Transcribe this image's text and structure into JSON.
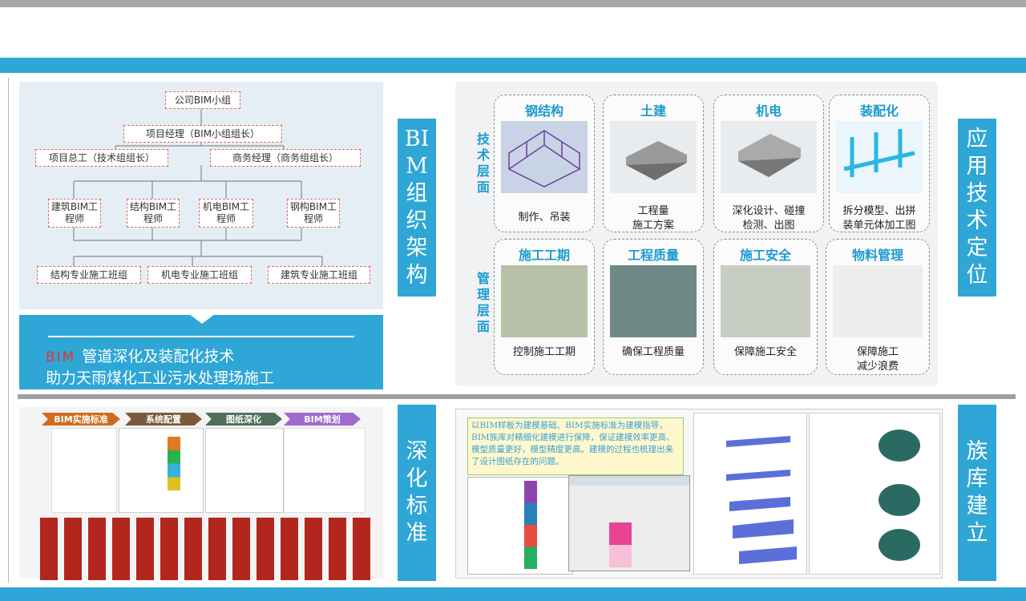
{
  "labels": {
    "org": "BIM组织架构",
    "tech": "应用技术定位",
    "deepen": "深化标准",
    "library": "族库建立"
  },
  "org_chart": {
    "company": "公司BIM小组",
    "pm": "项目经理（BIM小组组长）",
    "chief_engineer": "项目总工（技术组组长）",
    "business_manager": "商务经理（商务组组长）",
    "engineers": [
      "建筑BIM工程师",
      "结构BIM工程师",
      "机电BIM工程师",
      "钢构BIM工程师"
    ],
    "teams": [
      "结构专业施工班组",
      "机电专业施工班组",
      "建筑专业施工班组"
    ]
  },
  "caption": {
    "red": "BIM",
    "line1": "管道深化及装配化技术",
    "line2": "助力天雨煤化工业污水处理场施工"
  },
  "tech": {
    "side_tech": "技术层面",
    "side_mgmt": "管理层面",
    "tiles": [
      {
        "title": "钢结构",
        "caption": "制作、吊装"
      },
      {
        "title": "土建",
        "caption": "工程量\n施工方案"
      },
      {
        "title": "机电",
        "caption": "深化设计、碰撞\n检测、出图"
      },
      {
        "title": "装配化",
        "caption": "拆分模型、出拼\n装单元体加工图"
      },
      {
        "title": "施工工期",
        "caption": "控制施工工期"
      },
      {
        "title": "工程质量",
        "caption": "确保工程质量"
      },
      {
        "title": "施工安全",
        "caption": "保障施工安全"
      },
      {
        "title": "物料管理",
        "caption": "保障施工\n减少浪费"
      }
    ]
  },
  "doc": {
    "headers": [
      "BIM实施标准",
      "系统配置",
      "图纸深化",
      "BIM策划"
    ],
    "header_colors": [
      "#d2691e",
      "#7a5a3a",
      "#4f6f5a",
      "#a06ad0"
    ]
  },
  "library": {
    "note": "以BIM样板为建模基础、BIM实施标准为建模指导，BIM族库对精细化建模进行保障，保证建模效率更高、模型质量更好，模型精度更高。建模的过程也梳理出来了设计图纸存在的问题。"
  }
}
